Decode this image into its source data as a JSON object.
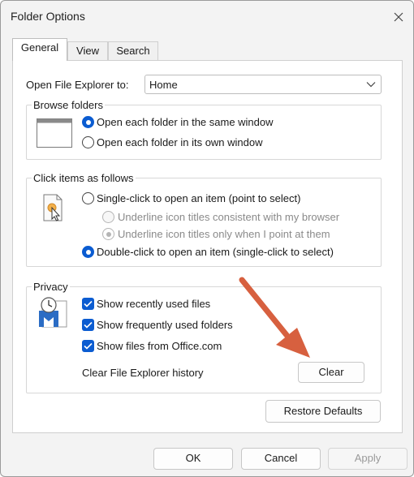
{
  "window": {
    "title": "Folder Options",
    "close_icon": "close-icon"
  },
  "tabs": [
    {
      "label": "General",
      "active": true
    },
    {
      "label": "View",
      "active": false
    },
    {
      "label": "Search",
      "active": false
    }
  ],
  "open_to": {
    "label": "Open File Explorer to:",
    "value": "Home"
  },
  "browse_folders": {
    "title": "Browse folders",
    "icon": "window-icon",
    "options": [
      {
        "label": "Open each folder in the same window",
        "checked": true
      },
      {
        "label": "Open each folder in its own window",
        "checked": false
      }
    ]
  },
  "click_items": {
    "title": "Click items as follows",
    "icon": "pointer-click-icon",
    "options": [
      {
        "label": "Single-click to open an item (point to select)",
        "checked": false
      },
      {
        "label": "Underline icon titles consistent with my browser",
        "checked": false,
        "disabled": true
      },
      {
        "label": "Underline icon titles only when I point at them",
        "checked": true,
        "disabled": true
      },
      {
        "label": "Double-click to open an item (single-click to select)",
        "checked": true
      }
    ]
  },
  "privacy": {
    "title": "Privacy",
    "icon": "privacy-history-icon",
    "checks": [
      {
        "label": "Show recently used files",
        "checked": true
      },
      {
        "label": "Show frequently used folders",
        "checked": true
      },
      {
        "label": "Show files from Office.com",
        "checked": true
      }
    ],
    "clear_history_label": "Clear File Explorer history",
    "clear_button": "Clear"
  },
  "restore_defaults": "Restore Defaults",
  "footer": {
    "ok": "OK",
    "cancel": "Cancel",
    "apply": "Apply",
    "apply_disabled": true
  },
  "colors": {
    "accent": "#0b5cd1",
    "arrow": "#d7603f"
  }
}
